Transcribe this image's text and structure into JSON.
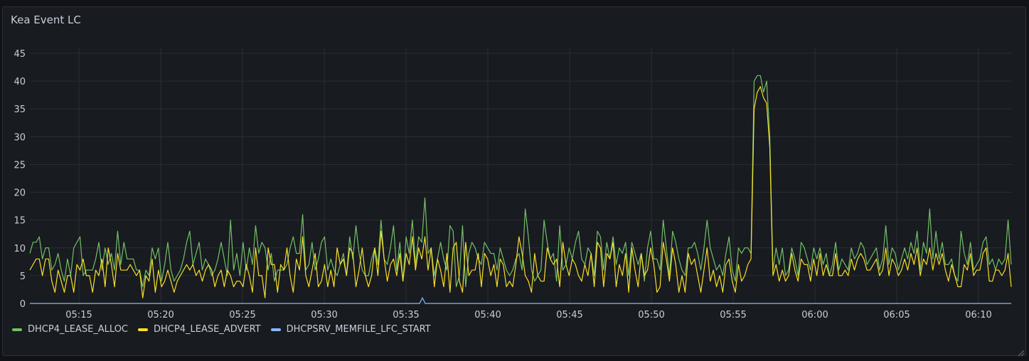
{
  "panel": {
    "title": "Kea Event LC"
  },
  "colors": {
    "background": "#181b1f",
    "grid": "#2a2d33",
    "alloc": "#73bf69",
    "advert": "#fade2a",
    "lfc": "#8ab8ff"
  },
  "chart_data": {
    "type": "line",
    "title": "Kea Event LC",
    "xlabel": "",
    "ylabel": "",
    "ylim": [
      0,
      45
    ],
    "y_ticks": [
      0,
      5,
      10,
      15,
      20,
      25,
      30,
      35,
      40,
      45
    ],
    "x_ticks": [
      "05:15",
      "05:20",
      "05:25",
      "05:30",
      "05:35",
      "05:40",
      "05:45",
      "05:50",
      "05:55",
      "06:00",
      "06:05",
      "06:10"
    ],
    "x_range": [
      "05:12",
      "06:12"
    ],
    "grid": true,
    "legend_position": "bottom-left",
    "series": [
      {
        "name": "DHCP4_LEASE_ALLOC",
        "color": "#73bf69",
        "values": [
          9,
          11,
          11,
          12,
          8,
          10,
          10,
          6,
          7,
          9,
          6,
          4,
          8,
          5,
          10,
          11,
          12,
          5,
          6,
          6,
          6,
          8,
          11,
          6,
          10,
          7,
          9,
          6,
          13,
          7,
          11,
          8,
          8,
          8,
          6,
          6,
          3,
          6,
          5,
          10,
          8,
          10,
          4,
          7,
          11,
          6,
          4,
          5,
          6,
          8,
          11,
          13,
          7,
          9,
          11,
          6,
          8,
          7,
          5,
          6,
          8,
          11,
          8,
          5,
          15,
          6,
          9,
          5,
          11,
          6,
          10,
          7,
          14,
          9,
          11,
          10,
          6,
          9,
          4,
          6,
          6,
          6,
          7,
          10,
          12,
          9,
          9,
          16,
          6,
          7,
          11,
          6,
          8,
          11,
          12,
          6,
          8,
          6,
          5,
          7,
          9,
          5,
          12,
          8,
          14,
          9,
          6,
          5,
          5,
          8,
          10,
          7,
          15,
          8,
          7,
          10,
          14,
          6,
          11,
          4,
          12,
          9,
          15,
          7,
          12,
          11,
          19,
          9,
          10,
          5,
          8,
          11,
          8,
          6,
          14,
          13,
          3,
          5,
          14,
          3,
          9,
          11,
          10,
          8,
          7,
          11,
          10,
          9,
          9,
          6,
          10,
          8,
          6,
          5,
          6,
          8,
          9,
          6,
          17,
          12,
          6,
          4,
          5,
          6,
          15,
          11,
          8,
          9,
          4,
          14,
          6,
          7,
          10,
          8,
          11,
          13,
          8,
          7,
          10,
          9,
          5,
          13,
          12,
          6,
          11,
          8,
          12,
          7,
          10,
          9,
          11,
          5,
          11,
          9,
          7,
          9,
          4,
          10,
          13,
          8,
          8,
          6,
          15,
          10,
          5,
          13,
          11,
          8,
          6,
          5,
          10,
          10,
          11,
          9,
          6,
          10,
          15,
          10,
          8,
          6,
          7,
          5,
          9,
          12,
          6,
          4,
          10,
          9,
          10,
          10,
          9,
          40,
          41,
          41,
          38,
          40,
          30,
          6,
          10,
          7,
          10,
          5,
          6,
          10,
          8,
          5,
          11,
          10,
          8,
          6,
          10,
          8,
          10,
          7,
          9,
          5,
          7,
          11,
          6,
          8,
          7,
          6,
          10,
          8,
          9,
          11,
          10,
          7,
          8,
          9,
          10,
          6,
          8,
          14,
          7,
          10,
          9,
          6,
          8,
          10,
          8,
          11,
          9,
          13,
          6,
          11,
          9,
          17,
          8,
          13,
          8,
          11,
          7,
          7,
          8,
          5,
          4,
          13,
          9,
          7,
          11,
          6,
          7,
          8,
          11,
          12,
          7,
          8,
          6,
          8,
          7,
          8,
          15,
          7
        ]
      },
      {
        "name": "DHCP4_LEASE_ADVERT",
        "color": "#fade2a",
        "values": [
          6,
          7,
          8,
          8,
          5,
          8,
          8,
          4,
          2,
          6,
          4,
          2,
          5,
          5,
          2,
          7,
          6,
          8,
          5,
          5,
          2,
          6,
          5,
          8,
          3,
          10,
          7,
          3,
          9,
          6,
          6,
          6,
          7,
          6,
          5,
          6,
          1,
          5,
          4,
          8,
          2,
          6,
          3,
          4,
          6,
          4,
          2,
          4,
          5,
          6,
          7,
          6,
          7,
          5,
          6,
          4,
          6,
          7,
          6,
          3,
          5,
          6,
          3,
          6,
          5,
          3,
          4,
          4,
          3,
          7,
          5,
          2,
          10,
          5,
          5,
          1,
          10,
          7,
          7,
          2,
          7,
          6,
          10,
          5,
          2,
          8,
          6,
          12,
          5,
          3,
          6,
          9,
          3,
          4,
          7,
          3,
          6,
          3,
          10,
          7,
          8,
          5,
          10,
          9,
          3,
          6,
          10,
          5,
          3,
          5,
          10,
          5,
          13,
          8,
          4,
          7,
          8,
          5,
          9,
          4,
          9,
          7,
          12,
          6,
          10,
          8,
          12,
          6,
          10,
          3,
          8,
          6,
          3,
          9,
          2,
          10,
          11,
          4,
          2,
          11,
          5,
          6,
          6,
          9,
          3,
          9,
          8,
          5,
          7,
          3,
          8,
          7,
          3,
          4,
          3,
          7,
          12,
          9,
          5,
          4,
          2,
          9,
          5,
          4,
          4,
          10,
          8,
          7,
          8,
          3,
          11,
          7,
          5,
          8,
          7,
          5,
          4,
          7,
          5,
          9,
          3,
          11,
          10,
          3,
          9,
          8,
          11,
          3,
          7,
          5,
          9,
          2,
          10,
          6,
          3,
          9,
          5,
          6,
          10,
          7,
          2,
          3,
          11,
          8,
          4,
          10,
          7,
          2,
          5,
          2,
          9,
          7,
          8,
          5,
          2,
          6,
          10,
          4,
          6,
          3,
          5,
          2,
          7,
          8,
          4,
          2,
          7,
          4,
          5,
          7,
          8,
          35,
          38,
          39,
          37,
          36,
          28,
          5,
          7,
          4,
          6,
          4,
          5,
          9,
          6,
          4,
          8,
          7,
          7,
          4,
          8,
          5,
          9,
          5,
          7,
          5,
          5,
          9,
          5,
          5,
          6,
          5,
          8,
          6,
          8,
          9,
          8,
          6,
          6,
          7,
          8,
          5,
          6,
          10,
          5,
          8,
          7,
          5,
          6,
          8,
          6,
          9,
          7,
          10,
          5,
          8,
          7,
          10,
          6,
          9,
          7,
          9,
          6,
          4,
          7,
          5,
          3,
          3,
          7,
          6,
          9,
          5,
          6,
          6,
          9,
          10,
          4,
          4,
          6,
          6,
          5,
          6,
          9,
          3
        ]
      },
      {
        "name": "DHCPSRV_MEMFILE_LFC_START",
        "color": "#8ab8ff",
        "spike_time": "05:36",
        "values_summary": "0 except a single value of 1 near 05:36"
      }
    ]
  },
  "legend": {
    "items": [
      {
        "label": "DHCP4_LEASE_ALLOC",
        "color": "#73bf69"
      },
      {
        "label": "DHCP4_LEASE_ADVERT",
        "color": "#fade2a"
      },
      {
        "label": "DHCPSRV_MEMFILE_LFC_START",
        "color": "#8ab8ff"
      }
    ]
  }
}
